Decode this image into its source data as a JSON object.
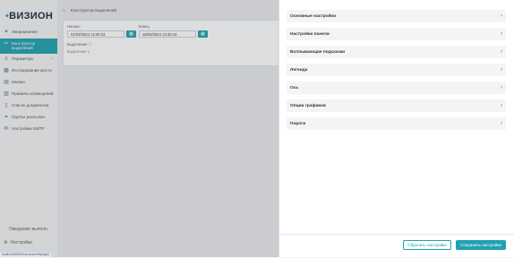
{
  "brand": {
    "logo": "ВИЗИОН",
    "accent": "#21a1b0"
  },
  "sidebar": {
    "items": [
      {
        "label": "Уведомления",
        "icon": "megaphone-icon",
        "active": false
      },
      {
        "label": "Конструктор выделений",
        "icon": "scissors-icon",
        "active": true
      },
      {
        "label": "Параметры",
        "icon": "sliders-icon",
        "active": false,
        "expandable": true
      },
      {
        "label": "Исследование места",
        "icon": "grid-icon",
        "active": false
      },
      {
        "label": "Мнемо",
        "icon": "layout-icon",
        "active": false
      },
      {
        "label": "Правила оповещений",
        "icon": "rules-icon",
        "active": false
      },
      {
        "label": "Список документов",
        "icon": "document-icon",
        "active": false
      },
      {
        "label": "Группы рассылки",
        "icon": "group-icon",
        "active": false
      },
      {
        "label": "Настройки SMTP",
        "icon": "mail-settings-icon",
        "active": false
      }
    ],
    "footer_label": "Ожидание выполн.",
    "settings_label": "Настройки"
  },
  "header": {
    "crumb": "Конструктор выделений"
  },
  "filters": {
    "start_label": "Начало",
    "start_value": "01/03/2024 12:00:24",
    "end_label": "Конец",
    "end_value": "16/03/2024 13:30:44",
    "info_label": "Выделения",
    "info_value": "выделение 1"
  },
  "panel": {
    "sections": [
      "Основные настройки",
      "Настройки панели",
      "Всплывающие подсказки",
      "Легенда",
      "Ось",
      "Опции графиков",
      "Пороги"
    ],
    "reset_label": "Сбросить настройки",
    "save_label": "Сохранить настройки"
  },
  "status_url": "localhost:8080/#/constructor/highlight"
}
